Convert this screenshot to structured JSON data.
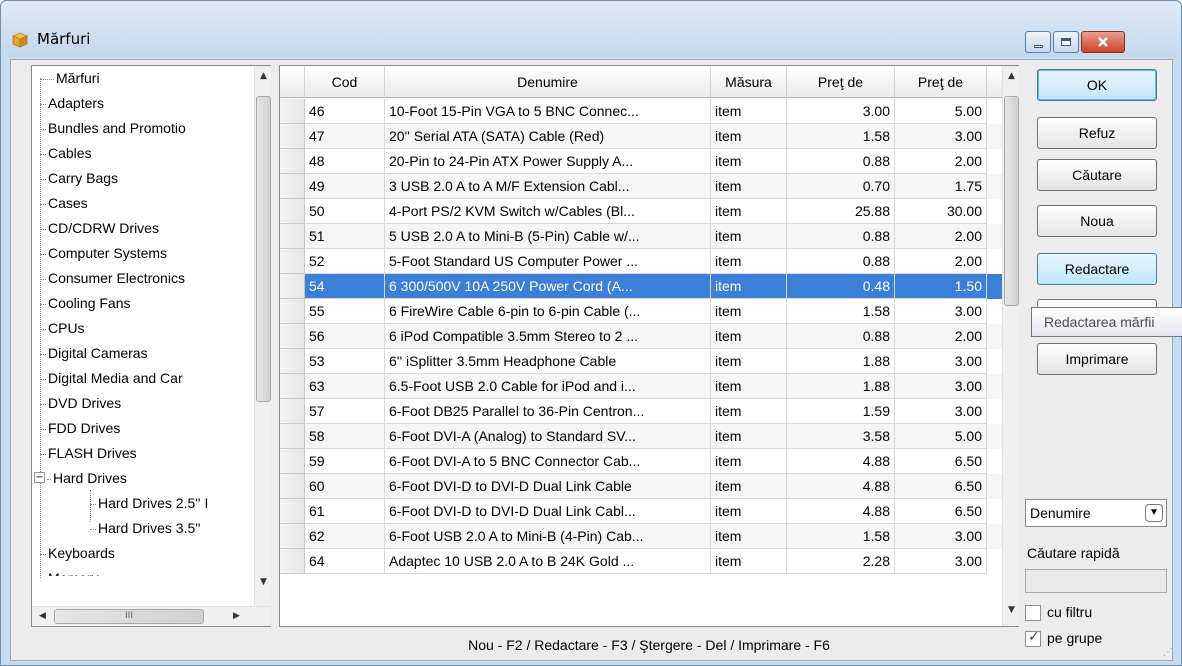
{
  "window": {
    "title": "Mărfuri",
    "controls": [
      "minimize",
      "maximize",
      "close"
    ]
  },
  "tree": {
    "root": "Mărfuri",
    "items": [
      {
        "label": "Adapters"
      },
      {
        "label": "Bundles and Promotio"
      },
      {
        "label": "Cables",
        "selected": true
      },
      {
        "label": "Carry Bags"
      },
      {
        "label": "Cases"
      },
      {
        "label": "CD/CDRW Drives"
      },
      {
        "label": "Computer Systems"
      },
      {
        "label": "Consumer Electronics"
      },
      {
        "label": "Cooling Fans"
      },
      {
        "label": "CPUs"
      },
      {
        "label": "Digital Cameras"
      },
      {
        "label": "Digital Media and Car"
      },
      {
        "label": "DVD Drives"
      },
      {
        "label": "FDD Drives"
      },
      {
        "label": "FLASH Drives"
      },
      {
        "label": "Hard Drives",
        "expanded": true
      },
      {
        "label": "Hard Drives 2.5'' I",
        "child": true
      },
      {
        "label": "Hard Drives 3.5''",
        "child": true
      },
      {
        "label": "Keyboards"
      },
      {
        "label": "Memory"
      }
    ],
    "hscroll_glyph": "III"
  },
  "grid": {
    "columns": [
      "Cod",
      "Denumire",
      "Măsura",
      "Preţ de",
      "Preţ de"
    ],
    "rows": [
      {
        "cod": "46",
        "denumire": "10-Foot 15-Pin VGA to 5 BNC Connec...",
        "masura": "item",
        "pret1": "3.00",
        "pret2": "5.00"
      },
      {
        "cod": "47",
        "denumire": "20'' Serial ATA (SATA) Cable (Red)",
        "masura": "item",
        "pret1": "1.58",
        "pret2": "3.00"
      },
      {
        "cod": "48",
        "denumire": "20-Pin to 24-Pin ATX Power Supply A...",
        "masura": "item",
        "pret1": "0.88",
        "pret2": "2.00"
      },
      {
        "cod": "49",
        "denumire": "3 USB 2.0 A to A M/F Extension Cabl...",
        "masura": "item",
        "pret1": "0.70",
        "pret2": "1.75"
      },
      {
        "cod": "50",
        "denumire": "4-Port PS/2 KVM Switch w/Cables (Bl...",
        "masura": "item",
        "pret1": "25.88",
        "pret2": "30.00"
      },
      {
        "cod": "51",
        "denumire": "5 USB 2.0 A to Mini-B (5-Pin) Cable w/...",
        "masura": "item",
        "pret1": "0.88",
        "pret2": "2.00"
      },
      {
        "cod": "52",
        "denumire": "5-Foot Standard US Computer Power ...",
        "masura": "item",
        "pret1": "0.88",
        "pret2": "2.00"
      },
      {
        "cod": "54",
        "denumire": "6 300/500V 10A 250V Power Cord (A...",
        "masura": "item",
        "pret1": "0.48",
        "pret2": "1.50",
        "selected": true
      },
      {
        "cod": "55",
        "denumire": "6 FireWire Cable 6-pin to 6-pin Cable (...",
        "masura": "item",
        "pret1": "1.58",
        "pret2": "3.00"
      },
      {
        "cod": "56",
        "denumire": "6 iPod Compatible 3.5mm Stereo to 2 ...",
        "masura": "item",
        "pret1": "0.88",
        "pret2": "2.00"
      },
      {
        "cod": "53",
        "denumire": "6'' iSplitter 3.5mm Headphone Cable",
        "masura": "item",
        "pret1": "1.88",
        "pret2": "3.00"
      },
      {
        "cod": "63",
        "denumire": "6.5-Foot USB 2.0 Cable for iPod and i...",
        "masura": "item",
        "pret1": "1.88",
        "pret2": "3.00"
      },
      {
        "cod": "57",
        "denumire": "6-Foot DB25 Parallel to 36-Pin Centron...",
        "masura": "item",
        "pret1": "1.59",
        "pret2": "3.00"
      },
      {
        "cod": "58",
        "denumire": "6-Foot DVI-A (Analog) to Standard SV...",
        "masura": "item",
        "pret1": "3.58",
        "pret2": "5.00"
      },
      {
        "cod": "59",
        "denumire": "6-Foot DVI-A to 5 BNC Connector Cab...",
        "masura": "item",
        "pret1": "4.88",
        "pret2": "6.50"
      },
      {
        "cod": "60",
        "denumire": "6-Foot DVI-D to DVI-D Dual Link Cable",
        "masura": "item",
        "pret1": "4.88",
        "pret2": "6.50"
      },
      {
        "cod": "61",
        "denumire": "6-Foot DVI-D to DVI-D Dual Link Cabl...",
        "masura": "item",
        "pret1": "4.88",
        "pret2": "6.50"
      },
      {
        "cod": "62",
        "denumire": "6-Foot USB 2.0 A to Mini-B (4-Pin) Cab...",
        "masura": "item",
        "pret1": "1.58",
        "pret2": "3.00"
      },
      {
        "cod": "64",
        "denumire": "Adaptec 10 USB 2.0 A to B 24K Gold ...",
        "masura": "item",
        "pret1": "2.28",
        "pret2": "3.00"
      }
    ]
  },
  "status": "Nou - F2 / Redactare - F3 / Ştergere - Del / Imprimare - F6",
  "buttons": {
    "ok": "OK",
    "refuz": "Refuz",
    "cautare": "Căutare",
    "noua": "Noua",
    "redactare": "Redactare",
    "imprimare": "Imprimare"
  },
  "tooltip": "Redactarea mărfii",
  "search": {
    "field_selected": "Denumire",
    "quick_label": "Căutare rapidă",
    "quick_value": ""
  },
  "checkboxes": {
    "cu_filtru": {
      "label": "cu filtru",
      "checked": false
    },
    "pe_grupe": {
      "label": "pe grupe",
      "checked": true
    }
  },
  "colors": {
    "selection": "#3b7fd6",
    "window_frame": "#c9dcef"
  }
}
